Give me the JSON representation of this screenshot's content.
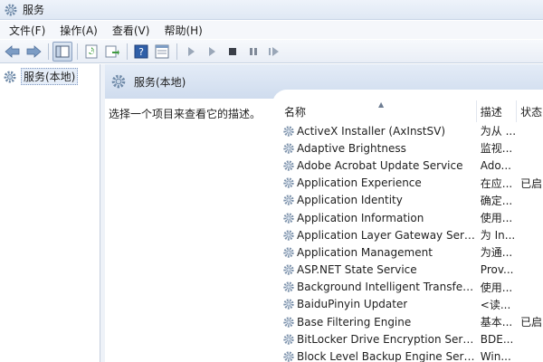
{
  "window": {
    "title": "服务"
  },
  "menu": [
    "文件(F)",
    "操作(A)",
    "查看(V)",
    "帮助(H)"
  ],
  "toolbar": [
    "back-icon",
    "forward-icon",
    "show-hide-console-tree-icon",
    "refresh-icon",
    "export-list-icon",
    "help-icon",
    "properties-icon",
    "start-service-icon",
    "start-icon-2",
    "stop-service-icon",
    "pause-service-icon",
    "restart-service-icon"
  ],
  "tree": {
    "root": "服务(本地)"
  },
  "right": {
    "header": "服务(本地)",
    "description_prompt": "选择一个项目来查看它的描述。",
    "columns": {
      "name": "名称",
      "description": "描述",
      "state": "状态"
    },
    "services": [
      {
        "name": "ActiveX Installer (AxInstSV)",
        "desc": "为从 ...",
        "state": ""
      },
      {
        "name": "Adaptive Brightness",
        "desc": "监视...",
        "state": ""
      },
      {
        "name": "Adobe Acrobat Update Service",
        "desc": "Ado...",
        "state": ""
      },
      {
        "name": "Application Experience",
        "desc": "在应...",
        "state": "已启"
      },
      {
        "name": "Application Identity",
        "desc": "确定...",
        "state": ""
      },
      {
        "name": "Application Information",
        "desc": "使用...",
        "state": ""
      },
      {
        "name": "Application Layer Gateway Service",
        "desc": "为 In...",
        "state": ""
      },
      {
        "name": "Application Management",
        "desc": "为通...",
        "state": ""
      },
      {
        "name": "ASP.NET State Service",
        "desc": "Prov...",
        "state": ""
      },
      {
        "name": "Background Intelligent Transfer Ser...",
        "desc": "使用...",
        "state": ""
      },
      {
        "name": "BaiduPinyin Updater",
        "desc": "<读...",
        "state": ""
      },
      {
        "name": "Base Filtering Engine",
        "desc": "基本...",
        "state": "已启"
      },
      {
        "name": "BitLocker Drive Encryption Service",
        "desc": "BDE...",
        "state": ""
      },
      {
        "name": "Block Level Backup Engine Service",
        "desc": "Win...",
        "state": ""
      }
    ]
  }
}
